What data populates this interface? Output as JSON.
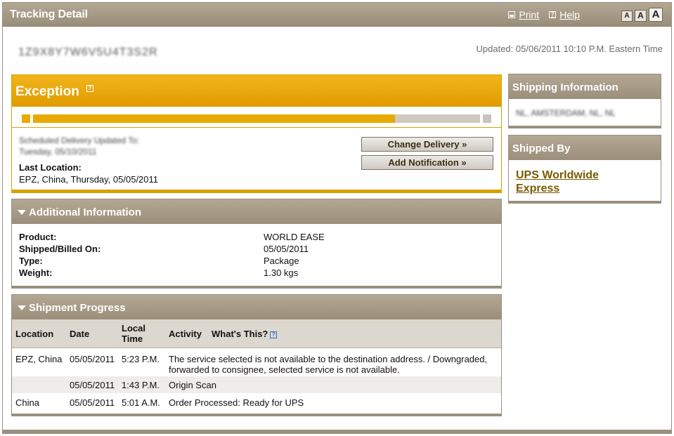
{
  "window": {
    "title": "Tracking Detail"
  },
  "toolbar": {
    "print_label": "Print",
    "help_label": "Help",
    "font_small": "A",
    "font_medium": "A",
    "font_large": "A"
  },
  "tracking": {
    "number": "1Z9X8Y7W6V5U4T3S2R",
    "updated": "Updated: 05/06/2011 10:10 P.M. Eastern Time"
  },
  "exception": {
    "title": "Exception",
    "progress_percent": 81,
    "blurred_line1": "Scheduled Delivery Updated To:",
    "blurred_line2": "Tuesday, 05/10/2011",
    "last_location_label": "Last Location:",
    "last_location_value": "EPZ, China, Thursday, 05/05/2011",
    "change_delivery_label": "Change Delivery »",
    "add_notification_label": "Add Notification »"
  },
  "additional_info": {
    "title": "Additional Information",
    "rows": [
      {
        "label": "Product:",
        "value": "WORLD EASE"
      },
      {
        "label": "Shipped/Billed On:",
        "value": "05/05/2011"
      },
      {
        "label": "Type:",
        "value": "Package"
      },
      {
        "label": "Weight:",
        "value": "1.30 kgs"
      }
    ]
  },
  "shipment_progress": {
    "title": "Shipment Progress",
    "headers": {
      "location": "Location",
      "date": "Date",
      "local_time_1": "Local",
      "local_time_2": "Time",
      "activity": "Activity",
      "whats_this": "What's This?"
    },
    "rows": [
      {
        "location": "EPZ, China",
        "date": "05/05/2011",
        "time": "5:23 P.M.",
        "activity": "The service selected is not available to the destination address. / Downgraded, forwarded to consignee, selected service is not available."
      },
      {
        "location": "",
        "date": "05/05/2011",
        "time": "1:43 P.M.",
        "activity": "Origin Scan"
      },
      {
        "location": "China",
        "date": "05/05/2011",
        "time": "5:01 A.M.",
        "activity": "Order Processed: Ready for UPS"
      }
    ]
  },
  "shipping_info": {
    "title": "Shipping Information",
    "blurred_value": "NL, AMSTERDAM, NL, NL"
  },
  "shipped_by": {
    "title": "Shipped By",
    "link": "UPS Worldwide Express"
  }
}
